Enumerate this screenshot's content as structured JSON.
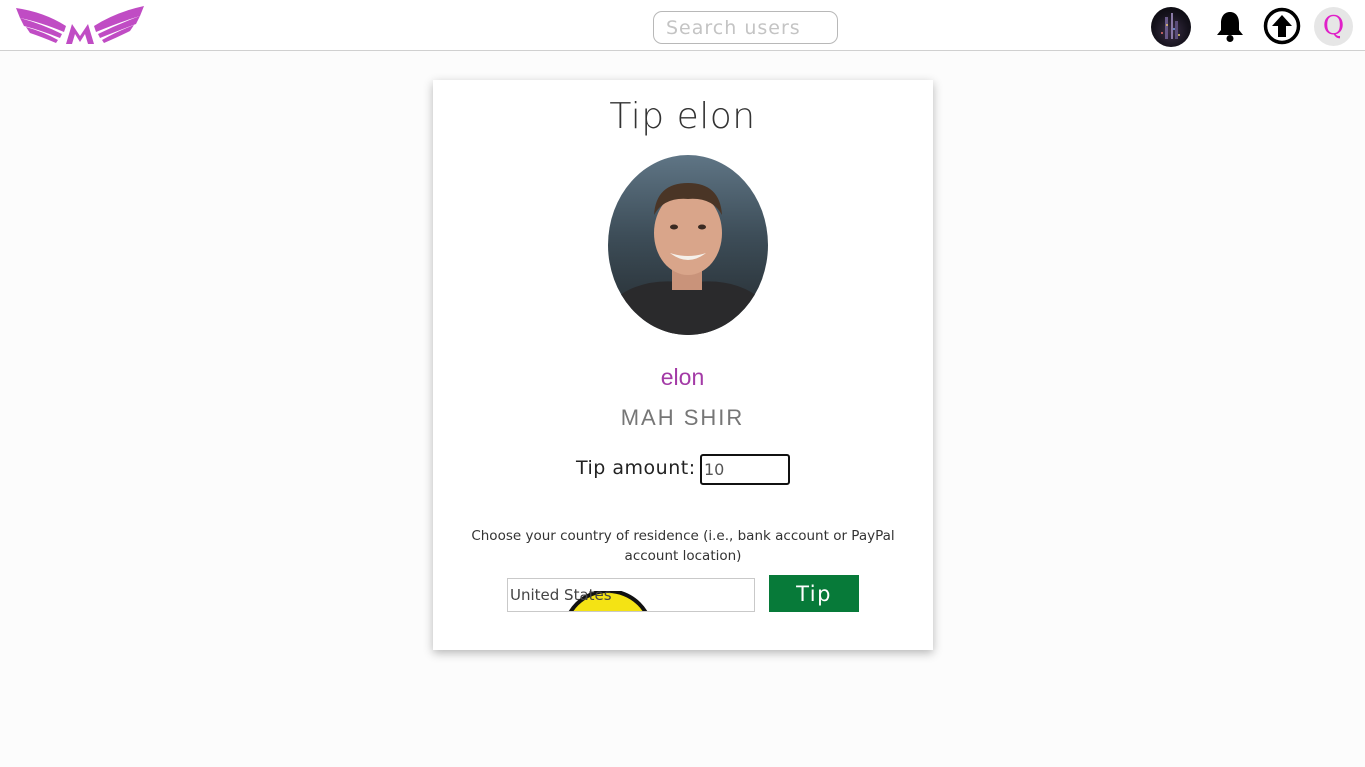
{
  "header": {
    "logo_icon": "winged-m-logo",
    "search": {
      "placeholder": "Search users",
      "value": ""
    },
    "icons": [
      "avatar",
      "bell-icon",
      "upload-arrow-icon"
    ],
    "profile_initial": "Q",
    "brand_color": "#c04cc4"
  },
  "tip_card": {
    "title": "Tip elon",
    "username": "elon",
    "display_name": "MAH SHIR",
    "tip_label": "Tip amount:",
    "tip_value": "10",
    "country_note": "Choose your country of residence (i.e., bank account or PayPal account location)",
    "country_value": "United States",
    "submit_label": "Tip",
    "colors": {
      "username": "#a33aa6",
      "button": "#077a39"
    }
  }
}
